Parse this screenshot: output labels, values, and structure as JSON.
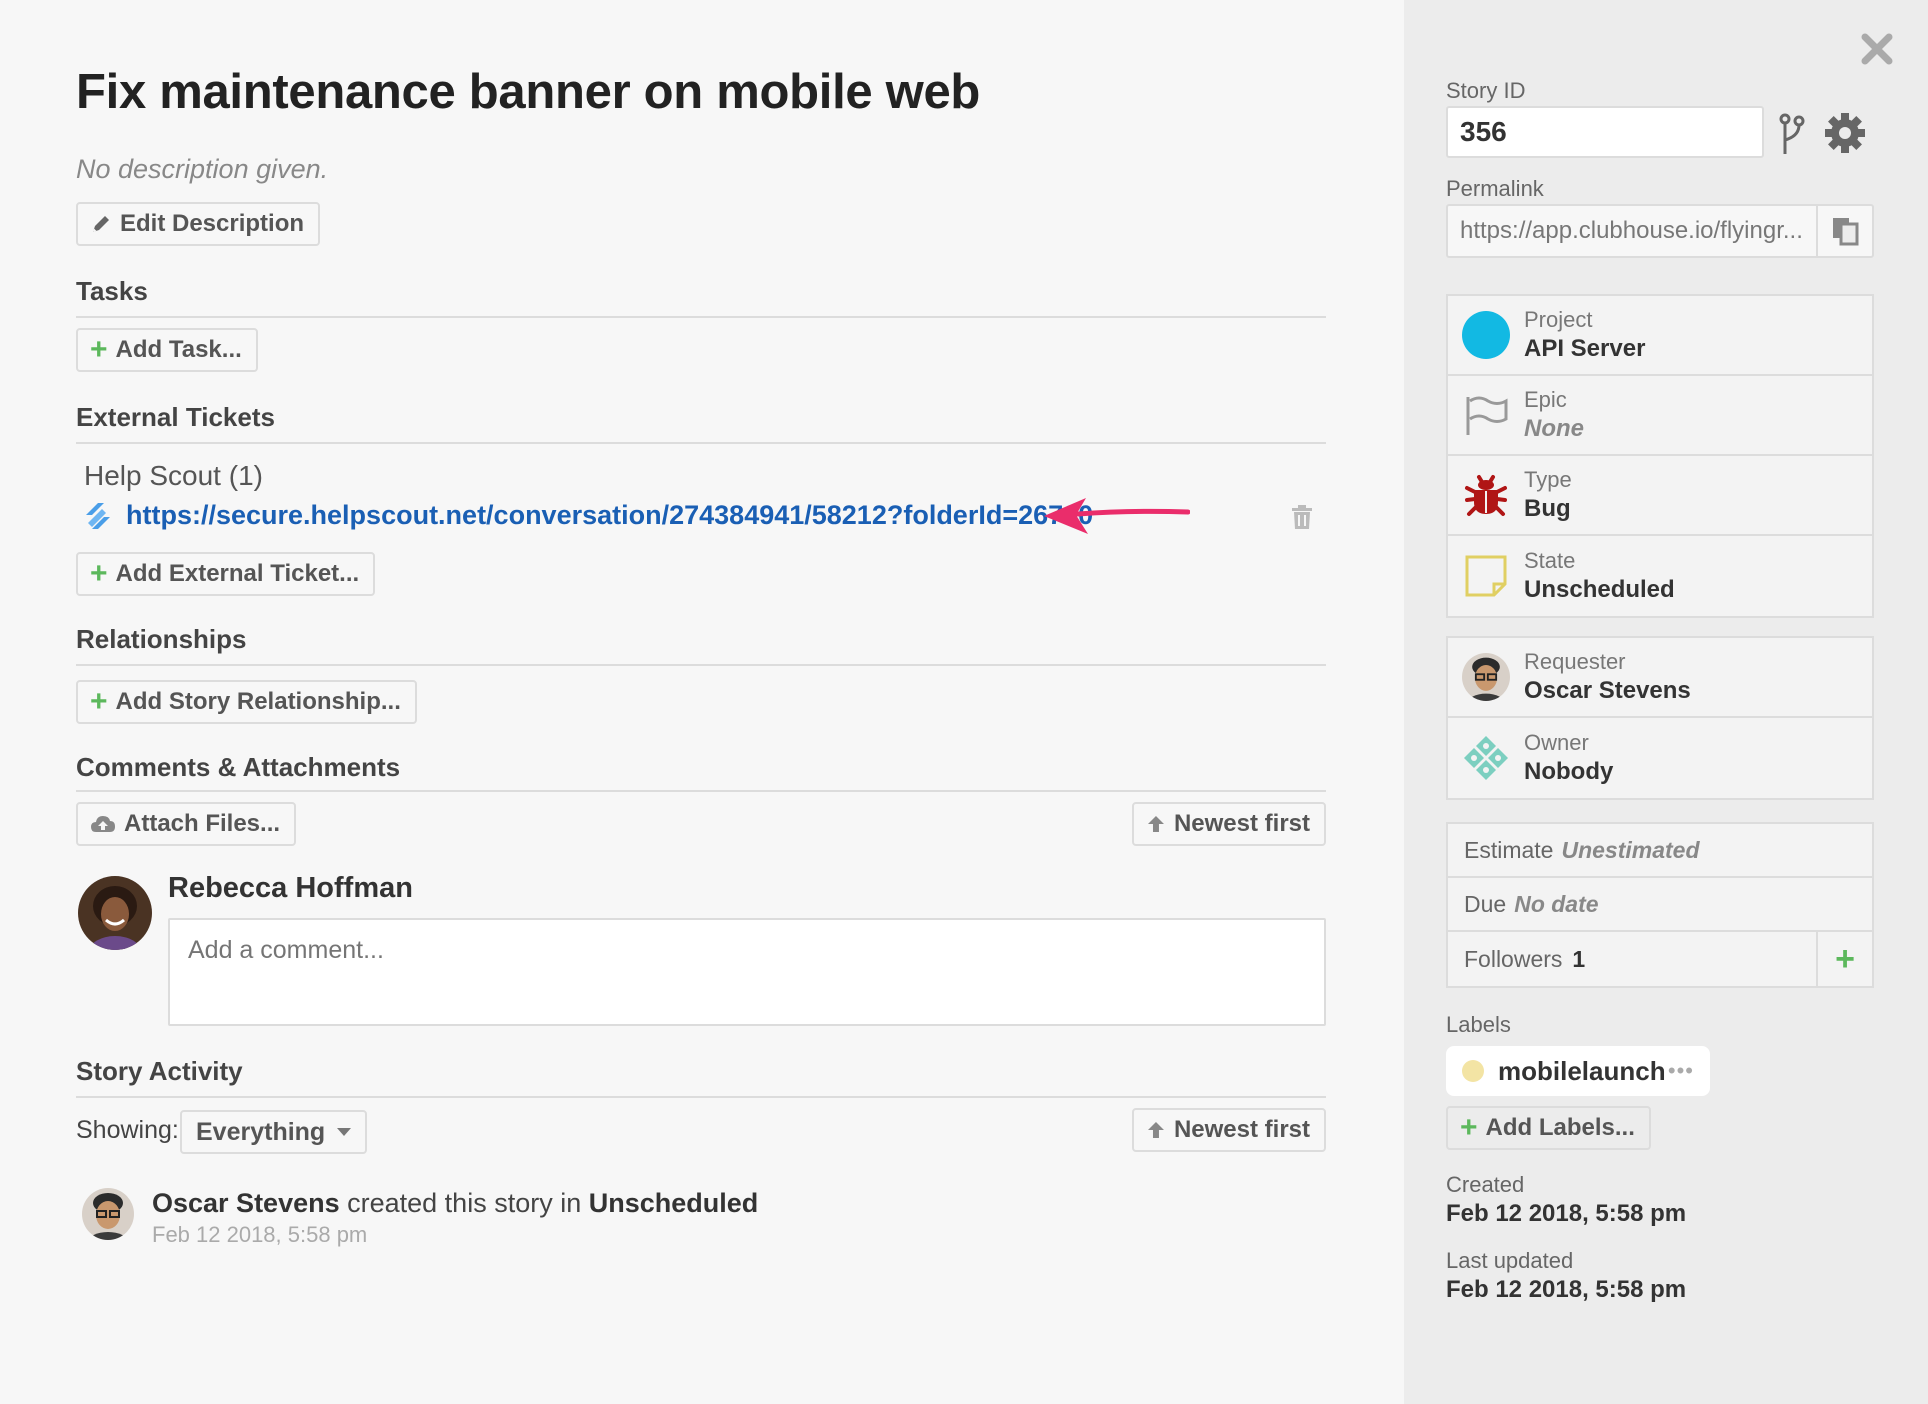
{
  "story": {
    "title": "Fix maintenance banner on mobile web",
    "description": "No description given.",
    "edit_description_label": "Edit Description"
  },
  "tasks": {
    "heading": "Tasks",
    "add_label": "Add Task..."
  },
  "external_tickets": {
    "heading": "External Tickets",
    "provider": "Help Scout (1)",
    "url": "https://secure.helpscout.net/conversation/274384941/58212?folderId=26700",
    "add_label": "Add External Ticket..."
  },
  "relationships": {
    "heading": "Relationships",
    "add_label": "Add Story Relationship..."
  },
  "comments": {
    "heading": "Comments & Attachments",
    "attach_label": "Attach Files...",
    "sort_label": "Newest first",
    "author": "Rebecca Hoffman",
    "placeholder": "Add a comment..."
  },
  "activity": {
    "heading": "Story Activity",
    "showing_label": "Showing:",
    "filter_value": "Everything",
    "sort_label": "Newest first",
    "actor": "Oscar Stevens",
    "action_text": " created this story in ",
    "target": "Unscheduled",
    "timestamp": "Feb 12 2018, 5:58 pm"
  },
  "sidebar": {
    "story_id_label": "Story ID",
    "story_id": "356",
    "permalink_label": "Permalink",
    "permalink": "https://app.clubhouse.io/flyingr...",
    "project": {
      "label": "Project",
      "value": "API Server",
      "color": "#12b9e3"
    },
    "epic": {
      "label": "Epic",
      "value": "None"
    },
    "type": {
      "label": "Type",
      "value": "Bug",
      "color": "#b01515"
    },
    "state": {
      "label": "State",
      "value": "Unscheduled",
      "color": "#e0cf62"
    },
    "requester": {
      "label": "Requester",
      "value": "Oscar Stevens"
    },
    "owner": {
      "label": "Owner",
      "value": "Nobody"
    },
    "estimate": {
      "label": "Estimate",
      "value": "Unestimated"
    },
    "due": {
      "label": "Due",
      "value": "No date"
    },
    "followers": {
      "label": "Followers",
      "value": "1"
    },
    "labels_heading": "Labels",
    "label_name": "mobilelaunch",
    "add_labels": "Add Labels...",
    "created_label": "Created",
    "created_value": "Feb 12 2018, 5:58 pm",
    "updated_label": "Last updated",
    "updated_value": "Feb 12 2018, 5:58 pm"
  },
  "icons": {
    "pencil": "pencil-icon",
    "plus": "plus-icon",
    "helpscout": "helpscout-icon",
    "trash": "trash-icon",
    "cloud_upload": "cloud-upload-icon",
    "arrow_up": "arrow-up-icon",
    "close": "close-icon",
    "branch": "git-branch-icon",
    "gear": "gear-icon",
    "copy": "copy-icon",
    "flag": "flag-icon",
    "bug": "bug-icon",
    "note": "note-icon",
    "annotation_arrow": "annotation-arrow-icon"
  },
  "colors": {
    "accent_link": "#1a5fb4",
    "add_green": "#5cb85c",
    "annotation_pink": "#ea2d6b"
  }
}
